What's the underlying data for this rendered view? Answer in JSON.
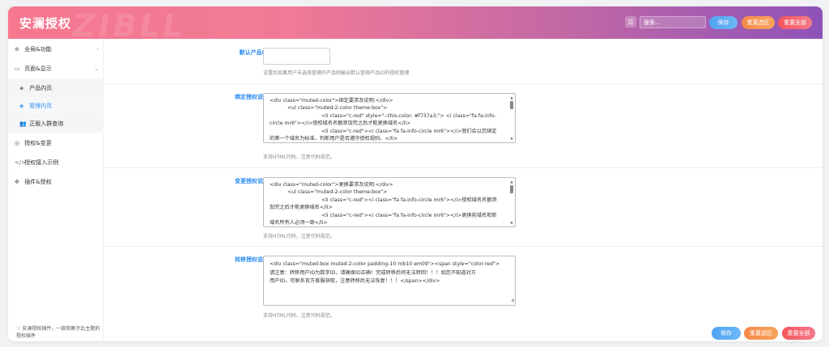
{
  "header": {
    "title": "安澜授权",
    "watermark": "ZIBLL",
    "search_placeholder": "搜索...",
    "save_label": "保存",
    "reset_section_label": "重置选区",
    "reset_all_label": "重置全部"
  },
  "sidebar": {
    "items": [
      {
        "label": "全局&功能",
        "icon": "globe-icon"
      },
      {
        "label": "页面&显示",
        "icon": "layout-icon"
      },
      {
        "label": "产品内页",
        "icon": "cube-icon"
      },
      {
        "label": "管理内页",
        "icon": "cube-icon"
      },
      {
        "label": "正版入群查询",
        "icon": "users-icon"
      },
      {
        "label": "授权&变更",
        "icon": "circle-icon"
      },
      {
        "label": "授权接入示例",
        "icon": "code-icon"
      },
      {
        "label": "插件&授权",
        "icon": "puzzle-icon"
      }
    ],
    "footer": "安澜授权插件，一款依赖子比主题的授权插件"
  },
  "fields": {
    "default_product": {
      "label": "默认产品ID",
      "value": "",
      "hint": "设置后如果用户未选择管理的产品则输出默认管理产品ID的授权管理"
    },
    "bind_desc": {
      "label": "绑定授权说明",
      "lines": [
        "<div class=\"muted-color\">绑定要求及说明:</div>",
        "<ul class=\"muted-2-color theme-box\">",
        "<li class=\"c-red\" style=\"--this-color: #f737a3;\"> <i class=\"fa fa-info-",
        "circle mr6\"></i>授权域名名额添加完之后才能更换域名</li>",
        "<li class=\"c-red\"><i class=\"fa fa-info-circle mr6\"></i>我们会以您绑定",
        "的第一个域名为标准，判断用户是否遵守授权规则。</li>"
      ],
      "hint": "支持HTML代码，注意代码规范。"
    },
    "change_desc": {
      "label": "变更授权说明",
      "lines": [
        "<div class=\"muted-color\">更换要求及说明:</div>",
        "<ul class=\"muted-2-color theme-box\">",
        "<li class=\"c-red\"><i class=\"fa fa-info-circle mr6\"></i>授权域名名额添",
        "加完之后才能更换域名</li>",
        "<li class=\"c-red\"><i class=\"fa fa-info-circle mr6\"></i>更换前域名和新",
        "域名所有人必须一致</li>"
      ],
      "hint": "支持HTML代码，注意代码规范。"
    },
    "transfer_desc": {
      "label": "转移授权说明",
      "lines": [
        "<div class=\"muted-box muted-2-color padding-10 mb10 em09\"><span style=\"color:red\">",
        "请注意：转移用户ID为数字ID，请确保ID正确！完成转移后将无法转回！！！如您不知道对方",
        "用户ID，可联系官方客服获取，注意转移后无法恢复！！！</span></div>"
      ],
      "hint": "支持HTML代码，注意代码规范。"
    }
  },
  "footer_actions": {
    "save_label": "保存",
    "reset_section_label": "重置选区",
    "reset_all_label": "重置全部"
  }
}
